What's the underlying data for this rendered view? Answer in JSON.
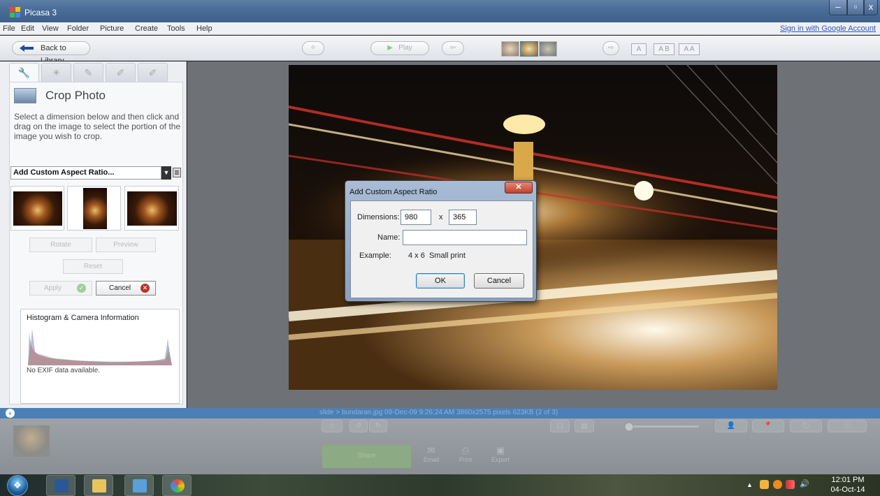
{
  "window": {
    "title": "Picasa 3",
    "min": "–",
    "max": "▫",
    "close": "x"
  },
  "menu": {
    "items": [
      "File",
      "Edit",
      "View",
      "Folder",
      "Picture",
      "Create",
      "Tools",
      "Help"
    ],
    "signin": "Sign in with Google Account"
  },
  "toolbar": {
    "back_label": "Back to Library",
    "play_label": "Play",
    "caption_buttons": [
      "A",
      "A B",
      "A A"
    ]
  },
  "tools_panel": {
    "tabs": [
      "wrench-icon",
      "tuning-icon",
      "brush-icon",
      "effects-icon",
      "effects2-icon"
    ],
    "crop_title": "Crop Photo",
    "crop_description": "Select a dimension below and then click and drag on the image to select the portion of the image you wish to crop.",
    "aspect_select": "Add Custom Aspect Ratio...",
    "rotate_label": "Rotate",
    "preview_label": "Preview",
    "reset_label": "Reset",
    "apply_label": "Apply",
    "cancel_label": "Cancel",
    "histogram_title": "Histogram & Camera Information",
    "exif_text": "No EXIF data available."
  },
  "dialog": {
    "title": "Add Custom Aspect Ratio",
    "dimensions_label": "Dimensions:",
    "width_value": "980",
    "x_label": "x",
    "height_value": "365",
    "name_label": "Name:",
    "name_value": "",
    "example_label": "Example:",
    "example_value": "4 x 6  Small print",
    "ok_label": "OK",
    "cancel_label": "Cancel"
  },
  "status": {
    "text": "slide > bundaran.jpg   09-Dec-09 9:26:24 AM   3860x2575 pixels   623KB   (2 of 3)"
  },
  "share": {
    "share_label": "Share",
    "email_label": "Email",
    "print_label": "Print",
    "export_label": "Export"
  },
  "taskbar": {
    "time": "12:01 PM",
    "date": "04-Oct-14"
  },
  "colors": {
    "titlebar": "#4a6e98",
    "statusbar": "#4a7fb8",
    "accent_link": "#3355bb"
  }
}
